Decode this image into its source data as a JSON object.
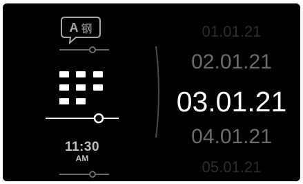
{
  "sidebar": {
    "language_button": {
      "letter": "A",
      "glyph": "钢",
      "icon": "speech-bubble-icon"
    },
    "keypad_icon": "keypad-icon",
    "clock": {
      "time": "11:30",
      "ampm": "AM"
    }
  },
  "date_picker": {
    "dates": [
      "01.01.21",
      "02.01.21",
      "03.01.21",
      "04.01.21",
      "05.01.21"
    ],
    "selected": "03.01.21"
  },
  "colors": {
    "background": "#000000",
    "primary_text": "#ffffff",
    "muted_text": "#6b6b6b",
    "faint_text": "#2d2d2d",
    "icon_gray": "#a6a6a6"
  }
}
